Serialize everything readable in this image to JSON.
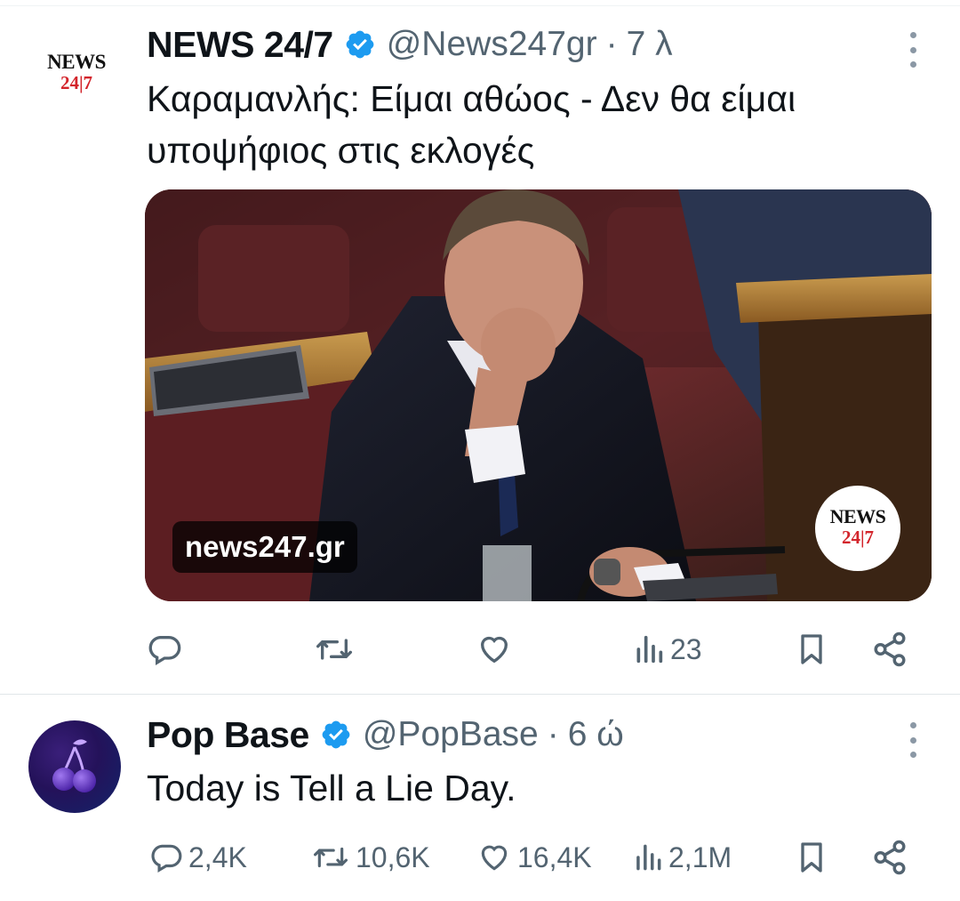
{
  "tweets": [
    {
      "author": {
        "name": "NEWS 24/7",
        "handle": "@News247gr",
        "avatar_text_top": "NEWS",
        "avatar_text_bottom": "24|7"
      },
      "time": "7 λ",
      "separator": "·",
      "text": "Καραμανλής: Είμαι αθώος - Δεν θα είμαι υποψήφιος στις εκλογές",
      "media": {
        "domain": "news247.gr",
        "watermark_top": "NEWS",
        "watermark_bottom": "24|7"
      },
      "stats": {
        "replies": "",
        "retweets": "",
        "likes": "",
        "views": "23"
      }
    },
    {
      "author": {
        "name": "Pop Base",
        "handle": "@PopBase"
      },
      "time": "6 ώ",
      "separator": "·",
      "text": "Today is Tell a Lie Day.",
      "stats": {
        "replies": "2,4K",
        "retweets": "10,6K",
        "likes": "16,4K",
        "views": "2,1M"
      }
    }
  ],
  "colors": {
    "verified": "#1d9bf0",
    "secondary_text": "#536471",
    "primary_text": "#0f1419",
    "brand_red": "#d3242b"
  },
  "icons": {
    "reply": "reply-icon",
    "retweet": "retweet-icon",
    "like": "like-icon",
    "views": "views-icon",
    "bookmark": "bookmark-icon",
    "share": "share-icon",
    "more": "more-icon",
    "verified": "verified-badge-icon"
  }
}
